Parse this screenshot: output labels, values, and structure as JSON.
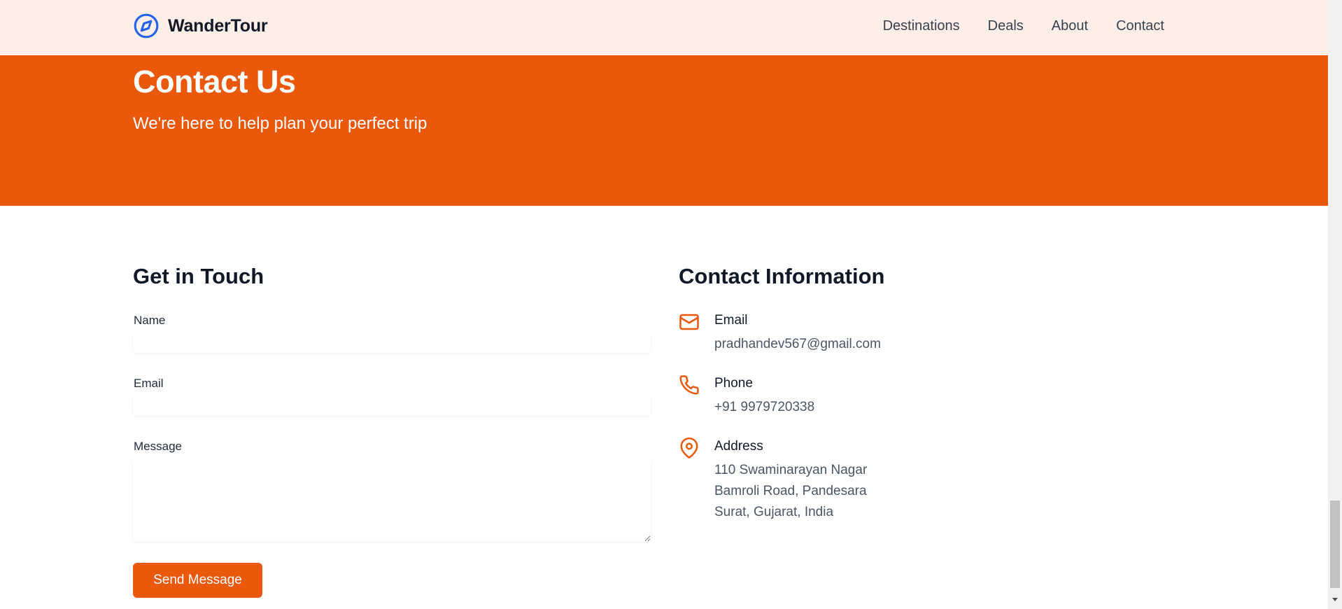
{
  "brand": {
    "name": "WanderTour",
    "icon": "compass-icon"
  },
  "nav": {
    "items": [
      "Destinations",
      "Deals",
      "About",
      "Contact"
    ]
  },
  "hero": {
    "title": "Contact Us",
    "subtitle": "We're here to help plan your perfect trip"
  },
  "form": {
    "title": "Get in Touch",
    "name_label": "Name",
    "name_value": "",
    "email_label": "Email",
    "email_value": "",
    "message_label": "Message",
    "message_value": "",
    "submit_label": "Send Message"
  },
  "contact_info": {
    "title": "Contact Information",
    "email": {
      "label": "Email",
      "value": "pradhandev567@gmail.com",
      "icon": "mail-icon"
    },
    "phone": {
      "label": "Phone",
      "value": "+91 9979720338",
      "icon": "phone-icon"
    },
    "address": {
      "label": "Address",
      "lines": [
        "110 Swaminarayan Nagar",
        "Bamroli Road, Pandesara",
        "Surat, Gujarat, India"
      ],
      "icon": "map-pin-icon"
    }
  },
  "colors": {
    "accent": "#ea580c",
    "nav_bg": "#fdeee8",
    "brand_icon": "#2563eb"
  }
}
